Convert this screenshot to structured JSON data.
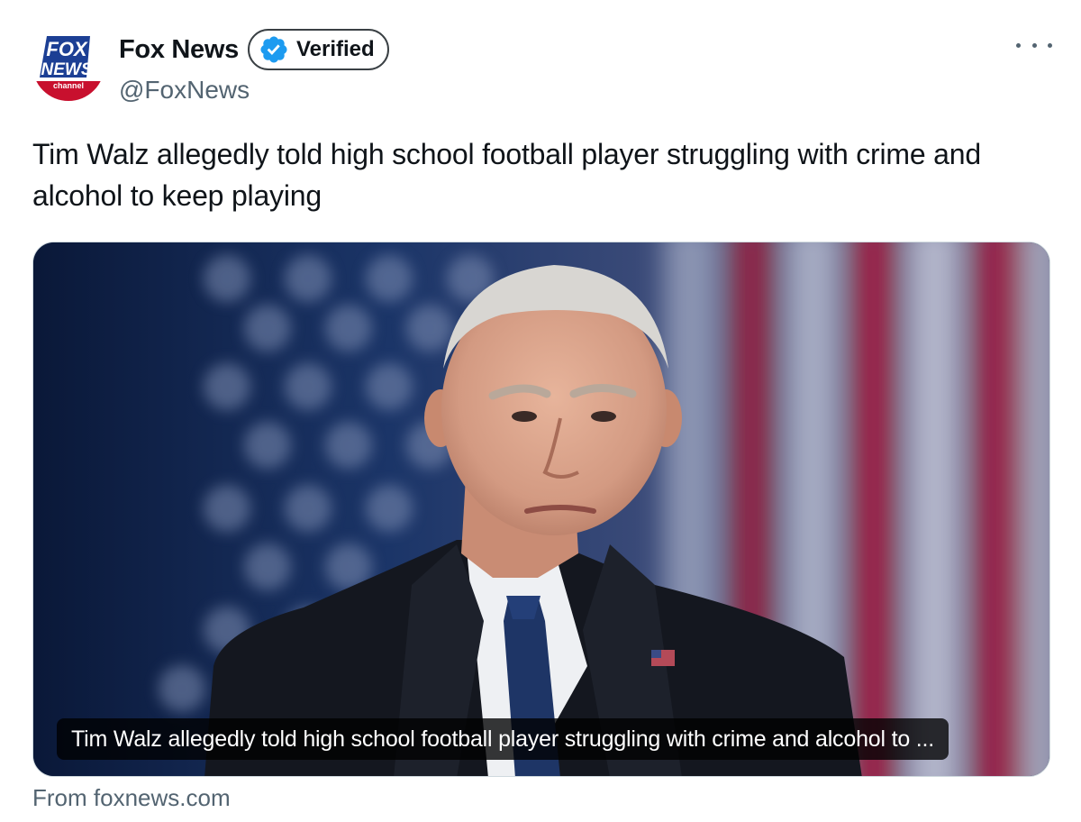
{
  "account": {
    "display_name": "Fox News",
    "verified_label": "Verified",
    "handle": "@FoxNews",
    "avatar_text": {
      "line1": "FOX",
      "line2": "NEWS",
      "line3": "channel"
    }
  },
  "tweet": {
    "text": "Tim Walz allegedly told high school football player struggling with crime and alcohol to keep playing"
  },
  "link_card": {
    "caption": "Tim Walz allegedly told high school football player struggling with crime and alcohol to ...",
    "source": "From foxnews.com"
  },
  "icons": {
    "more": "more-horizontal-icon",
    "verified": "verified-badge-icon"
  },
  "colors": {
    "verified_blue": "#1d9bf0",
    "text_primary": "#0f1419",
    "text_secondary": "#536471",
    "card_border": "#cfd9de",
    "fox_blue": "#1c3f94",
    "fox_red": "#c8102e"
  }
}
